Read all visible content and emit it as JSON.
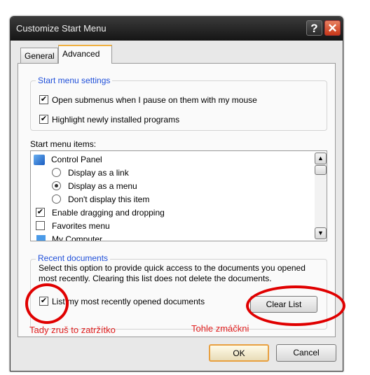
{
  "window": {
    "title": "Customize Start Menu",
    "help_label": "?",
    "close_label": "✕"
  },
  "tabs": [
    {
      "label": "General"
    },
    {
      "label": "Advanced"
    }
  ],
  "start_menu_settings": {
    "legend": "Start menu settings",
    "options": [
      {
        "label": "Open submenus when I pause on them with my mouse",
        "checked": true
      },
      {
        "label": "Highlight newly installed programs",
        "checked": true
      }
    ]
  },
  "start_menu_items": {
    "label": "Start menu items:",
    "items": [
      {
        "type": "header",
        "label": "Control Panel",
        "icon": "control-panel-icon"
      },
      {
        "type": "radio",
        "label": "Display as a link",
        "selected": false
      },
      {
        "type": "radio",
        "label": "Display as a menu",
        "selected": true
      },
      {
        "type": "radio",
        "label": "Don't display this item",
        "selected": false
      },
      {
        "type": "checkbox",
        "label": "Enable dragging and dropping",
        "checked": true
      },
      {
        "type": "checkbox",
        "label": "Favorites menu",
        "checked": false
      },
      {
        "type": "header",
        "label": "My Computer",
        "icon": "computer-icon"
      }
    ]
  },
  "recent_documents": {
    "legend": "Recent documents",
    "description": "Select this option to provide quick access to the documents you opened most recently.  Clearing this list does not delete the documents.",
    "list_option": {
      "label": "List my most recently opened documents",
      "checked": true
    },
    "clear_button": "Clear List"
  },
  "annotations": {
    "uncheck_note": "Tady zruš to zatržítko",
    "press_note": "Tohle zmáčkni",
    "color": "#e00000"
  },
  "footer": {
    "ok": "OK",
    "cancel": "Cancel"
  }
}
